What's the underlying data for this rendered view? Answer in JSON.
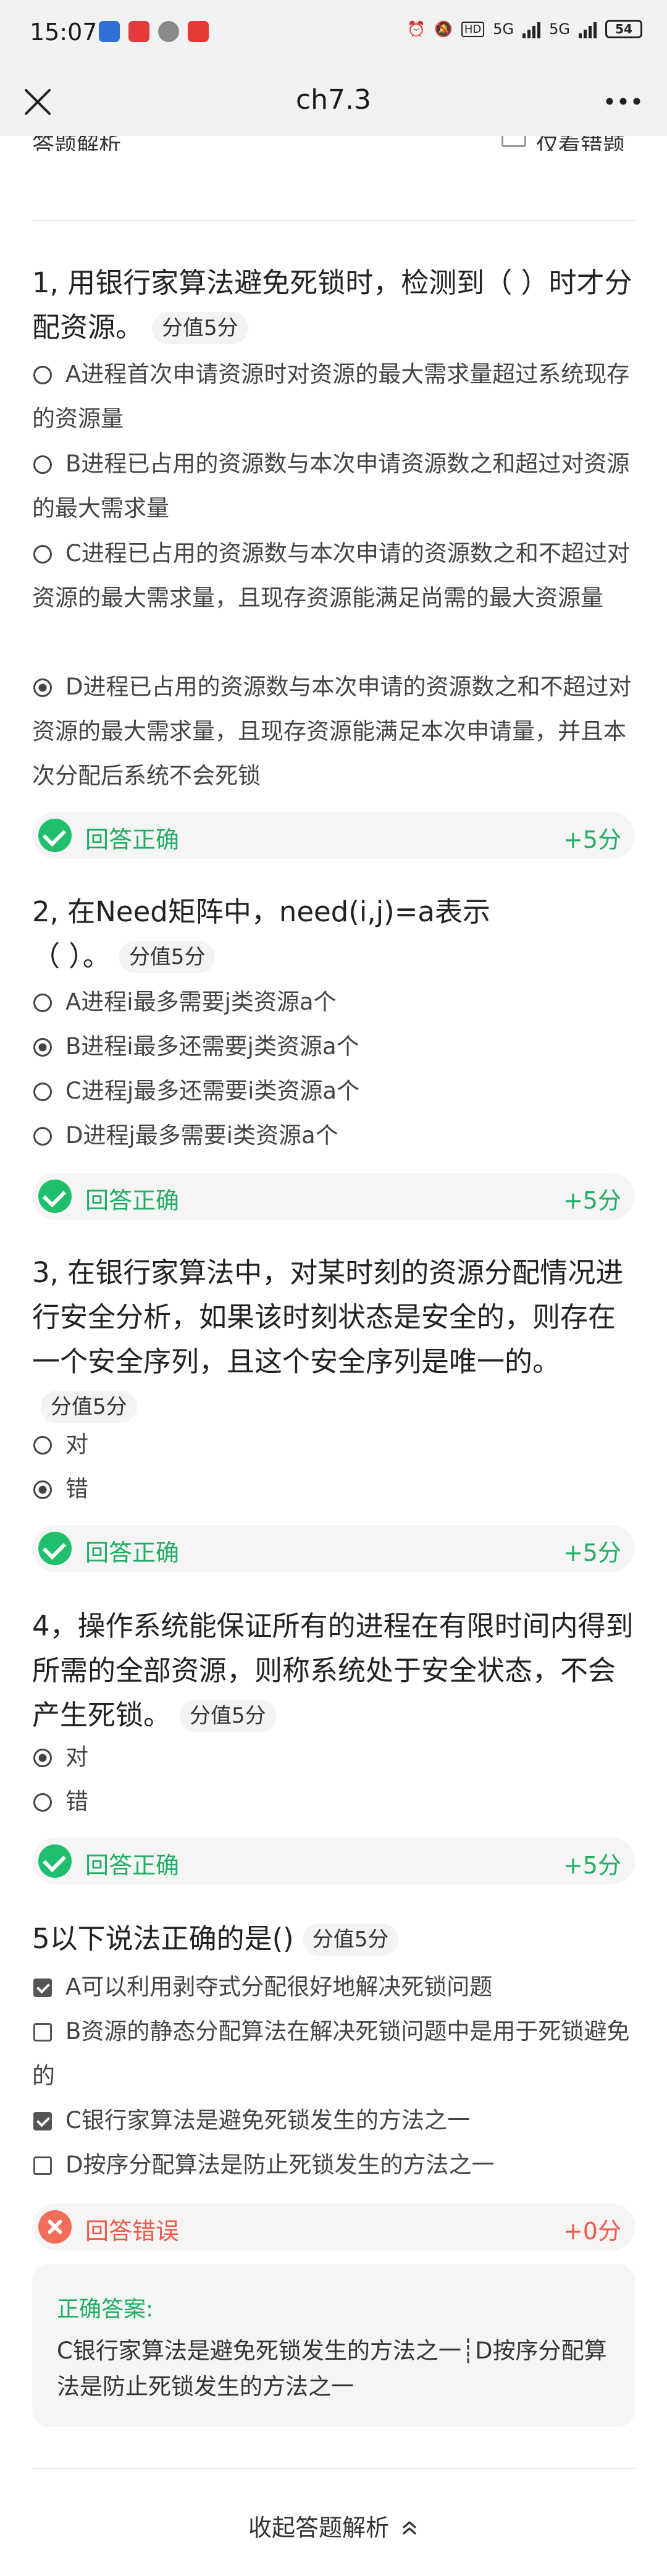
{
  "status_bar": {
    "time": "15:07",
    "network_labels": [
      "HD",
      "5G",
      "5G"
    ],
    "battery": "54"
  },
  "nav": {
    "title": "ch7.3"
  },
  "header_clipped": {
    "left_text": "答题解析",
    "right_text": "仅看错题"
  },
  "questions": [
    {
      "title": "1, 用银行家算法避免死锁时，检测到（ ）时才分配资源。",
      "score": "分值5分",
      "options": [
        "A进程首次申请资源时对资源的最大需求量超过系统现存的资源量",
        "B进程已占用的资源数与本次申请资源数之和超过对资源的最大需求量",
        "C进程已占用的资源数与本次申请的资源数之和不超过对资源的最大需求量，且现存资源能满足尚需的最大资源量",
        "D进程已占用的资源数与本次申请的资源数之和不超过对资源的最大需求量，且现存资源能满足本次申请量，并且本次分配后系统不会死锁"
      ],
      "result": "回答正确",
      "gain": "+5分"
    },
    {
      "title": "2, 在Need矩阵中，need(i,j)=a表示（ ）。",
      "score": "分值5分",
      "options": [
        "A进程i最多需要j类资源a个",
        "B进程i最多还需要j类资源a个",
        "C进程j最多还需要i类资源a个",
        "D进程j最多需要i类资源a个"
      ],
      "result": "回答正确",
      "gain": "+5分"
    },
    {
      "title": "3, 在银行家算法中，对某时刻的资源分配情况进行安全分析，如果该时刻状态是安全的，则存在一个安全序列，且这个安全序列是唯一的。",
      "score": "分值5分",
      "options": [
        "对",
        "错"
      ],
      "result": "回答正确",
      "gain": "+5分"
    },
    {
      "title": "4，操作系统能保证所有的进程在有限时间内得到所需的全部资源，则称系统处于安全状态，不会产生死锁。",
      "score": "分值5分",
      "options": [
        "对",
        "错"
      ],
      "result": "回答正确",
      "gain": "+5分"
    },
    {
      "title": "5以下说法正确的是()",
      "score": "分值5分",
      "options": [
        "A可以利用剥夺式分配很好地解决死锁问题",
        "B资源的静态分配算法在解决死锁问题中是用于死锁避免的",
        "C银行家算法是避免死锁发生的方法之一",
        "D按序分配算法是防止死锁发生的方法之一"
      ],
      "result": "回答错误",
      "gain": "+0分"
    }
  ],
  "correct_answer": {
    "label": "正确答案:",
    "text": "C银行家算法是避免死锁发生的方法之一┊D按序分配算法是防止死锁发生的方法之一"
  },
  "footer": {
    "collapse_label": "收起答题解析"
  },
  "colors": {
    "correct": "#1fae62",
    "wrong": "#ef5a4a",
    "background": "#ffffff",
    "bar": "#f2f2f2"
  },
  "selected": {
    "q1": "D",
    "q2": "B",
    "q3": "错",
    "q4": "对",
    "q5": [
      "A",
      "C"
    ]
  }
}
